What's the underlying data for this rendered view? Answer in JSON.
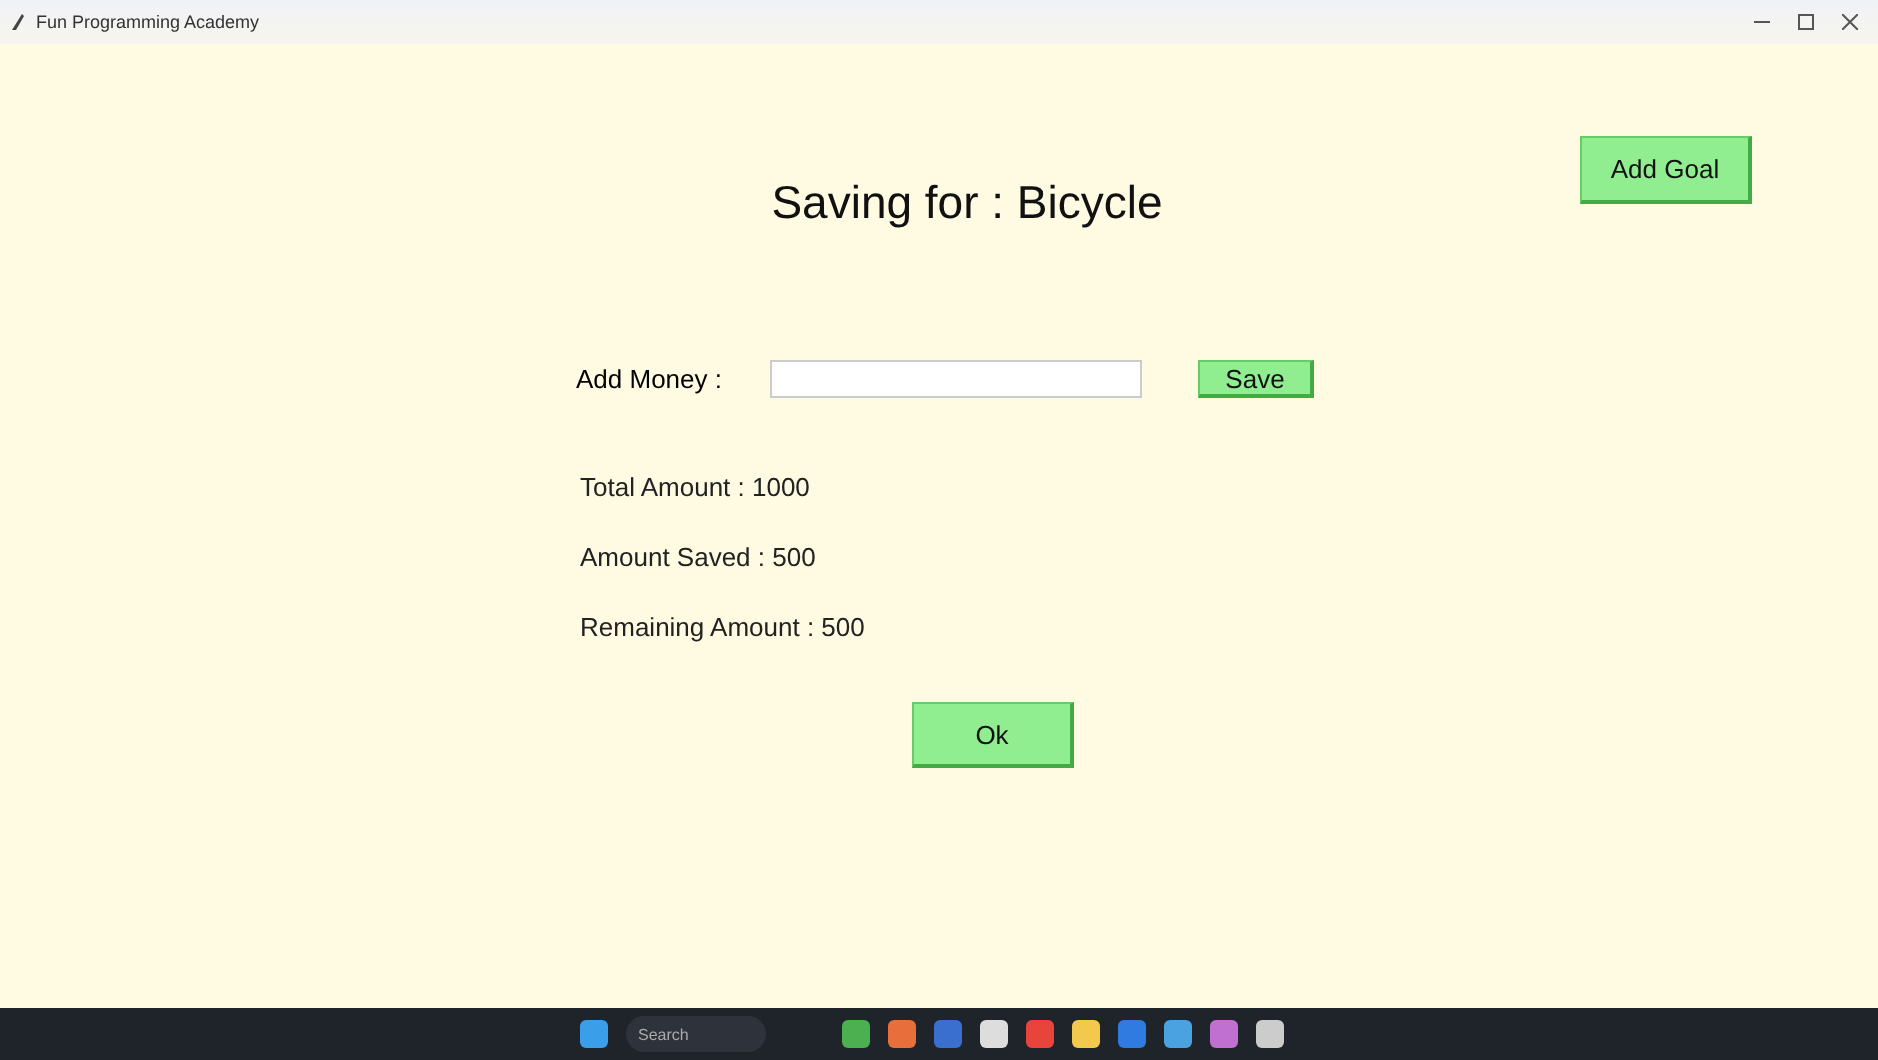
{
  "window": {
    "title": "Fun Programming Academy"
  },
  "heading": "Saving for : Bicycle",
  "add_goal_button": "Add Goal",
  "add_money": {
    "label": "Add Money :",
    "button": "Save"
  },
  "summary": [
    {
      "label": "Total Amount : 1000"
    },
    {
      "label": "Amount Saved : 500"
    },
    {
      "label": "Remaining Amount : 500"
    }
  ],
  "ok_button": "Ok",
  "taskbar": {
    "search": {
      "placeholder": "Search"
    }
  }
}
